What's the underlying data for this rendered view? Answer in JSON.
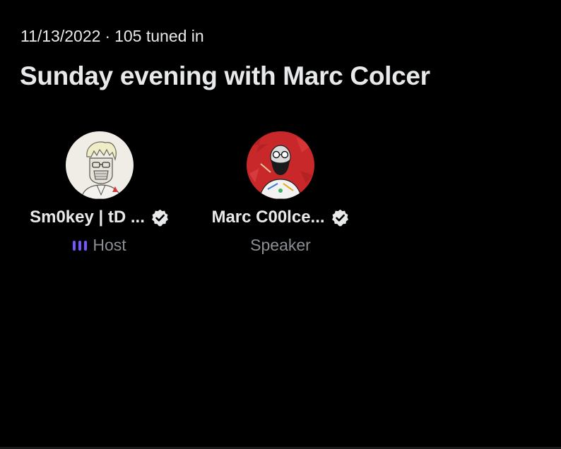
{
  "space": {
    "date": "11/13/2022",
    "separator": "·",
    "tuned_in": "105 tuned in",
    "title": "Sunday evening with Marc Colcer"
  },
  "participants": [
    {
      "name": "Sm0key | tD ...",
      "role": "Host",
      "verified": true,
      "speaking_indicator": "audio-bars-icon"
    },
    {
      "name": "Marc C00lce...",
      "role": "Speaker",
      "verified": true
    }
  ],
  "colors": {
    "background": "#000000",
    "text_primary": "#e7e9ea",
    "text_secondary": "#8b8f94",
    "host_indicator": "#7856ff",
    "verified_badge": "#e7e9ea",
    "avatar2_background": "#c8282a"
  }
}
